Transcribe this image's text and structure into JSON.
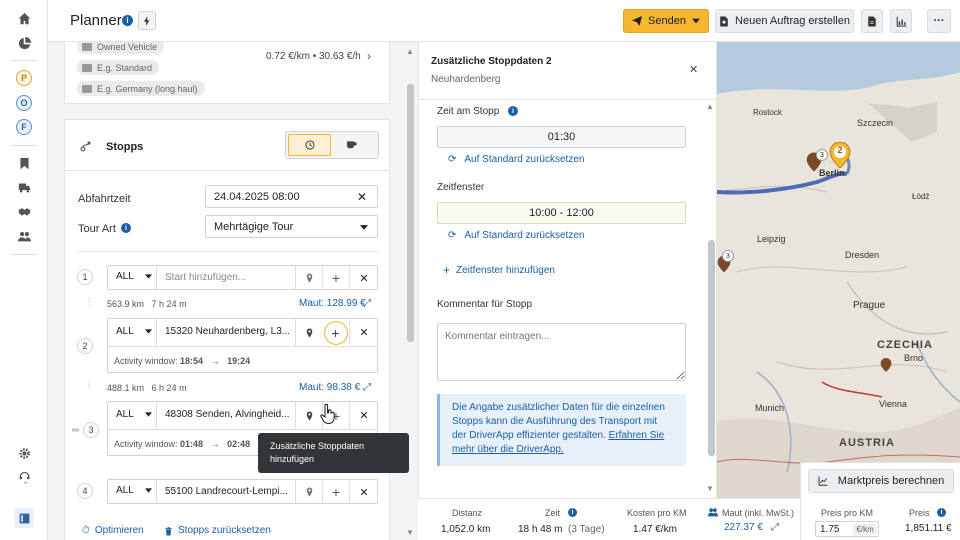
{
  "app": {
    "title": "Planner"
  },
  "toolbar": {
    "send_label": "Senden",
    "new_order_label": "Neuen Auftrag erstellen"
  },
  "sidebar": {
    "avatars": [
      "P",
      "O",
      "F"
    ]
  },
  "vehicle": {
    "pills": [
      "Owned Vehicle",
      "E.g. Standard",
      "E.g. Germany (long haul)"
    ],
    "cost": "0.72 €/km • 30.63 €/h"
  },
  "stops": {
    "header": "Stopps",
    "departure_label": "Abfahrtzeit",
    "departure_value": "24.04.2025 08:00",
    "tour_type_label": "Tour Art",
    "tour_type_value": "Mehrtägige Tour",
    "rows": [
      {
        "num": "1",
        "type": "ALL",
        "address": "",
        "placeholder": "Start hinzufügen..."
      },
      {
        "num": "2",
        "type": "ALL",
        "address": "15320 Neuhardenberg, L3...",
        "window_label": "Activity window:",
        "window_from": "18:54",
        "window_to": "19:24"
      },
      {
        "num": "3",
        "type": "ALL",
        "address": "48308 Senden, Alvingheid...",
        "window_label": "Activity window:",
        "window_from": "01:48",
        "window_to": "02:48"
      },
      {
        "num": "4",
        "type": "ALL",
        "address": "55100 Landrecourt-Lempi..."
      }
    ],
    "legs": [
      {
        "dist": "563.9 km",
        "time": "7 h 24 m",
        "maut": "Maut: 128.99 €"
      },
      {
        "dist": "488.1 km",
        "time": "6 h 24 m",
        "maut": "Maut: 98.38 €"
      }
    ],
    "optimize_label": "Optimieren",
    "reset_label": "Stopps zurücksetzen"
  },
  "tooltip": {
    "text": "Zusätzliche Stoppdaten hinzufügen"
  },
  "panel": {
    "title": "Zusätzliche Stoppdaten 2",
    "subtitle": "Neuhardenberg",
    "stop_time_label": "Zeit am Stopp",
    "stop_time_value": "01:30",
    "reset_default": "Auf Standard zurücksetzen",
    "window_label": "Zeitfenster",
    "window_value": "10:00 - 12:00",
    "add_window": "Zeitfenster hinzufügen",
    "comment_label": "Kommentar für Stopp",
    "comment_placeholder": "Kommentar eintragen...",
    "info_text": "Die Angabe zusätzlicher Daten für die einzelnen Stopps kann die Ausführung des Transport mit der DriverApp effizienter gestalten.",
    "info_link": "Erfahren Sie mehr über die DriverApp."
  },
  "map": {
    "cities": [
      "Szczecin",
      "Berlin",
      "Leipzig",
      "Dresden",
      "Prague",
      "CZECHIA",
      "Brno",
      "Munich",
      "Vienna",
      "AUSTRIA",
      "Rostock",
      "Łódź"
    ],
    "markers": [
      "3",
      "2",
      "3"
    ],
    "market_price_button": "Marktpreis berechnen",
    "price_per_km_label": "Preis pro KM",
    "price_per_km_value": "1.75",
    "price_per_km_unit": "€/km",
    "price_label": "Preis",
    "price_value": "1,851.11 €"
  },
  "summary": {
    "distance_label": "Distanz",
    "distance_value": "1,052.0 km",
    "time_label": "Zeit",
    "time_value": "18 h 48 m",
    "time_days": "(3 Tage)",
    "cost_label": "Kosten pro KM",
    "cost_value": "1.47 €/km",
    "toll_label": "Maut (inkl. MwSt.)",
    "toll_value": "227.37 €"
  },
  "colors": {
    "accent": "#f5b731",
    "link": "#1a5fa8",
    "route": "#3a5fb0",
    "info_bg": "#e8f1fa"
  }
}
